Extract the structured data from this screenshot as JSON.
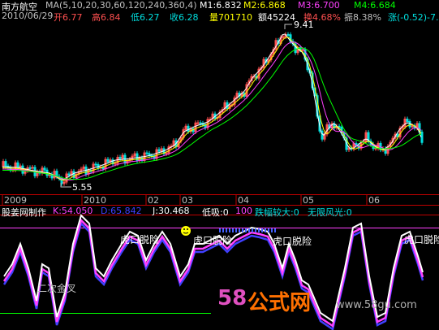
{
  "colors": {
    "background": "#000000",
    "up": "#ff5050",
    "down": "#00e0e0",
    "white": "#ffffff",
    "yellow": "#ffff00",
    "magenta": "#ff40ff",
    "green": "#00ff00",
    "blue": "#4040ff",
    "axis": "#c00000",
    "watermark_58": "#e050c0",
    "watermark_gs": "#ff7000"
  },
  "header": {
    "stock_name": "南方航空",
    "ma_params": "MA(5,10,20,30,60,120,240,360,4)",
    "m1": "M1:6.832",
    "m2": "M2:6.868",
    "m3": "M3:6.700",
    "m4": "M4:6.684",
    "date": "2010/06/29",
    "open": "开6.77",
    "high": "高6.84",
    "low": "低6.27",
    "close": "收6.28",
    "volume": "量701710",
    "amount": "额45224",
    "turnover": "换4.68%",
    "amplitude": "振8.38%",
    "change": "涨(-0.52)-7."
  },
  "price_annotations": {
    "high_label": "9.41",
    "low_label": "5.55"
  },
  "time_axis": {
    "labels": [
      "2009",
      "2010",
      "02",
      "03",
      "04",
      "05",
      "06"
    ]
  },
  "indicator": {
    "title": "股姜网制作",
    "k": "K:54.050",
    "d": "D:65.842",
    "j": "J:30.468",
    "low_suck": "低吸:0",
    "score": "100",
    "big_swing": "跌幅较大:0",
    "scenery": "无限风光:0",
    "tiger_labels": [
      "虎口脱险",
      "虎口脱险",
      "虎口脱险",
      "虎口脱险"
    ],
    "bottom_label": "二次金叉"
  },
  "watermark": {
    "number": "58",
    "brand": "公式网",
    "url": "www.58gu.com"
  }
}
